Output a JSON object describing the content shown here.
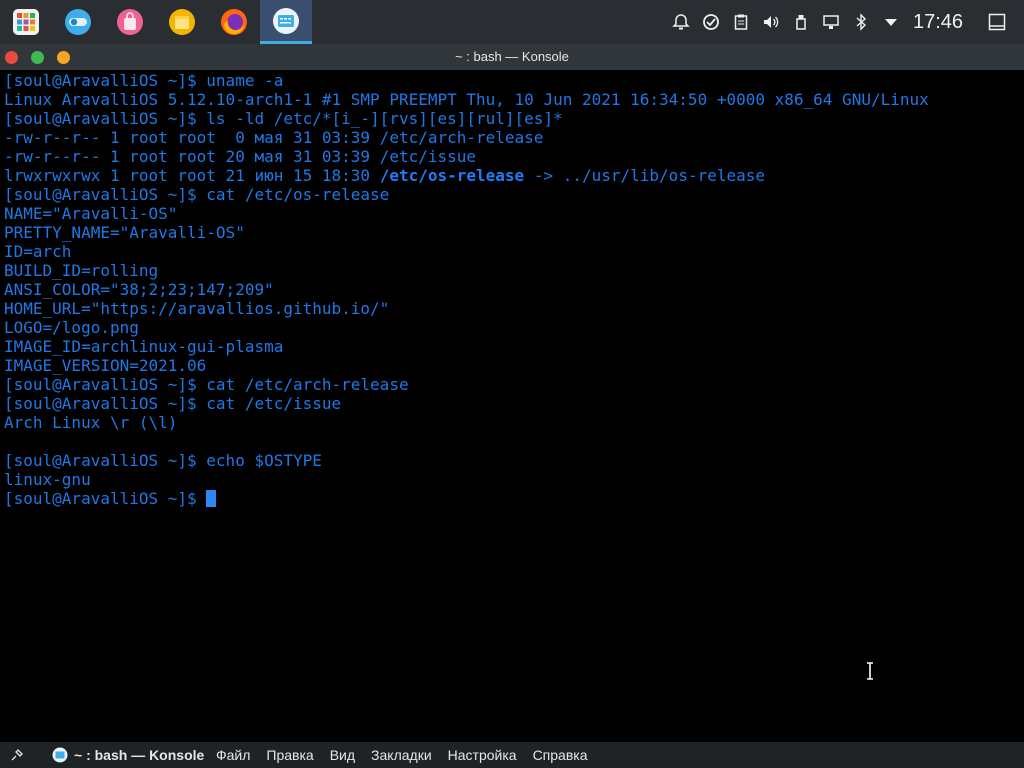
{
  "panel": {
    "launchers": [
      {
        "name": "app-launcher-icon",
        "color": "#e74c3c"
      },
      {
        "name": "settings-toggle-icon",
        "color": "#3daee9"
      },
      {
        "name": "store-bag-icon",
        "color": "#f06292"
      },
      {
        "name": "file-manager-icon",
        "color": "#f5b400"
      },
      {
        "name": "firefox-icon",
        "color": "#ff6611"
      },
      {
        "name": "konsole-icon",
        "color": "#3daee9"
      }
    ],
    "tray_icons": [
      "notifications-icon",
      "updates-icon",
      "clipboard-icon",
      "volume-icon",
      "usb-icon",
      "display-icon",
      "bluetooth-icon",
      "expand-tray-icon"
    ],
    "clock": "17:46"
  },
  "window": {
    "title": "~ : bash — Konsole",
    "buttons": {
      "close": "#e74c3c",
      "maximize": "#3fb950",
      "minimize": "#f5a623"
    }
  },
  "terminal": {
    "lines": [
      "[soul@AravalliOS ~]$ uname -a",
      "Linux AravalliOS 5.12.10-arch1-1 #1 SMP PREEMPT Thu, 10 Jun 2021 16:34:50 +0000 x86_64 GNU/Linux",
      "[soul@AravalliOS ~]$ ls -ld /etc/*[i_-][rvs][es][rul][es]*",
      "-rw-r--r-- 1 root root  0 мая 31 03:39 /etc/arch-release",
      "-rw-r--r-- 1 root root 20 мая 31 03:39 /etc/issue",
      {
        "prefix": "lrwxrwxrwx 1 root root 21 июн 15 18:30 ",
        "bold": "/etc/os-release",
        "suffix": " -> ../usr/lib/os-release"
      },
      "[soul@AravalliOS ~]$ cat /etc/os-release",
      "NAME=\"Aravalli-OS\"",
      "PRETTY_NAME=\"Aravalli-OS\"",
      "ID=arch",
      "BUILD_ID=rolling",
      "ANSI_COLOR=\"38;2;23;147;209\"",
      "HOME_URL=\"https://aravallios.github.io/\"",
      "LOGO=/logo.png",
      "IMAGE_ID=archlinux-gui-plasma",
      "IMAGE_VERSION=2021.06",
      "[soul@AravalliOS ~]$ cat /etc/arch-release",
      "[soul@AravalliOS ~]$ cat /etc/issue",
      "Arch Linux \\r (\\l)",
      "",
      "[soul@AravalliOS ~]$ echo $OSTYPE",
      "linux-gnu"
    ],
    "prompt": "[soul@AravalliOS ~]$ "
  },
  "bottom_bar": {
    "title": "~ : bash — Konsole",
    "menu": [
      "Файл",
      "Правка",
      "Вид",
      "Закладки",
      "Настройка",
      "Справка"
    ]
  }
}
